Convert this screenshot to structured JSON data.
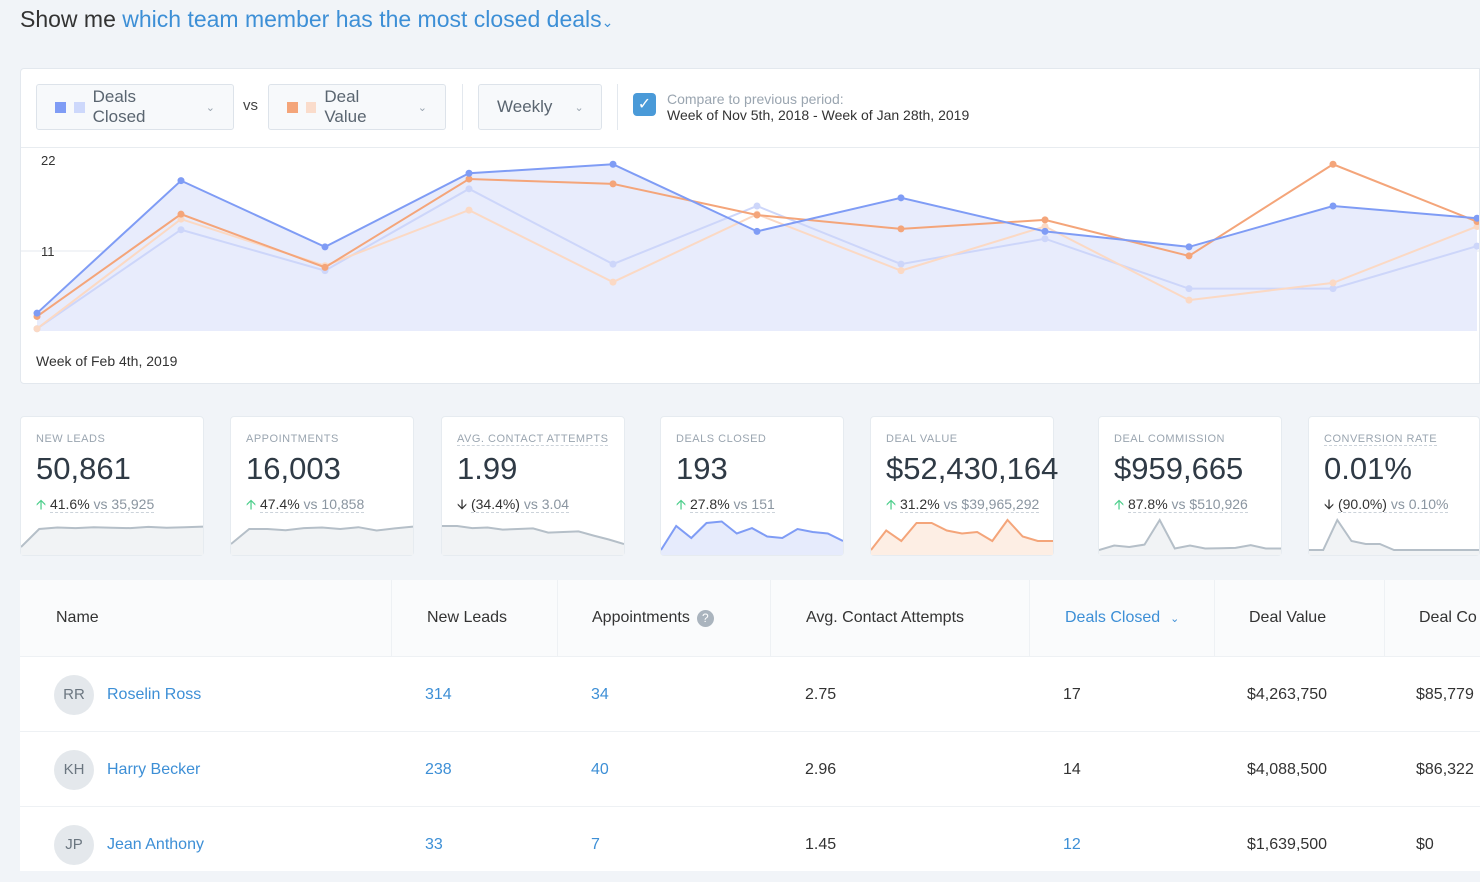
{
  "header": {
    "prefix": "Show me",
    "query": "which team member has the most closed deals",
    "chevron": "chevron-down-icon"
  },
  "controls": {
    "metric1": {
      "label": "Deals Closed",
      "colors": [
        "#7f9cf5",
        "#cdd8fb"
      ]
    },
    "vs": "vs",
    "metric2": {
      "label": "Deal Value",
      "colors": [
        "#f4a57a",
        "#fadccb"
      ]
    },
    "interval": "Weekly",
    "compare": {
      "checked": true,
      "label": "Compare to previous period:",
      "range": "Week of Nov 5th, 2018 - Week of Jan 28th, 2019"
    }
  },
  "chart_data": {
    "type": "line",
    "yticks": [
      "22",
      "11"
    ],
    "ylim": [
      0,
      22
    ],
    "xlabel": "Week of Feb 4th, 2019",
    "grid": true,
    "series": [
      {
        "key": "deals_prev",
        "color": "#cdd6fa",
        "values": [
          1.5,
          13.6,
          8.6,
          18.6,
          9.4,
          16.5,
          9.4,
          12.5,
          6.4,
          6.4,
          11.6
        ]
      },
      {
        "key": "value_prev",
        "color": "#fbd9c4",
        "values": [
          1.5,
          14.9,
          9.2,
          16,
          7.2,
          15.5,
          8.6,
          14,
          5,
          7.1,
          14
        ]
      },
      {
        "key": "value",
        "color": "#f4a57a",
        "values": [
          3,
          15.5,
          9,
          19.8,
          19.2,
          15.4,
          13.7,
          14.8,
          10.4,
          21.6,
          14.6
        ]
      },
      {
        "key": "deals",
        "color": "#7f9cf5",
        "values": [
          3.4,
          19.6,
          11.5,
          20.5,
          21.6,
          13.4,
          17.5,
          13.4,
          11.5,
          16.5,
          15
        ]
      }
    ]
  },
  "kpis": [
    {
      "label": "NEW LEADS",
      "value": "50,861",
      "dir": "up",
      "change": "41.6%",
      "vs": "vs 35,925",
      "color": "#b5bfc8",
      "fill": "#f1f3f5",
      "spark": [
        2,
        8,
        8.5,
        8.3,
        8.6,
        8.4,
        8.3,
        8.7,
        8.4,
        8.6,
        8.8
      ]
    },
    {
      "label": "APPOINTMENTS",
      "value": "16,003",
      "dir": "up",
      "change": "47.4%",
      "vs": "vs 10,858",
      "color": "#b5bfc8",
      "fill": "#f1f3f5",
      "spark": [
        3,
        8,
        8,
        7.6,
        8.3,
        8.5,
        8,
        8.6,
        7.5,
        8.2,
        8.8
      ]
    },
    {
      "label": "AVG. CONTACT ATTEMPTS",
      "value": "1.99",
      "dir": "down",
      "change": "(34.4%)",
      "vs": "vs 3.04",
      "color": "#b5bfc8",
      "fill": "#f1f3f5",
      "spark": [
        9,
        9,
        8.3,
        8.5,
        7.8,
        8,
        8.2,
        6.8,
        7,
        7.2,
        5.8,
        4.5,
        3
      ]
    },
    {
      "label": "DEALS CLOSED",
      "value": "193",
      "dir": "up",
      "change": "27.8%",
      "vs": "vs 151",
      "color": "#7f9cf5",
      "fill": "#e6ebfc",
      "spark": [
        1,
        9,
        5,
        10,
        10.5,
        6.5,
        8.3,
        5.5,
        5,
        8,
        7,
        6.5,
        4
      ]
    },
    {
      "label": "DEAL VALUE",
      "value": "$52,430,164",
      "dir": "up",
      "change": "31.2%",
      "vs": "vs $39,965,292",
      "color": "#f4a57a",
      "fill": "#fdeee4",
      "spark": [
        1,
        7.5,
        4,
        10,
        10,
        7.5,
        6.5,
        7,
        4,
        11,
        5.5,
        4,
        4
      ]
    },
    {
      "label": "DEAL COMMISSION",
      "value": "$959,665",
      "dir": "up",
      "change": "87.8%",
      "vs": "vs $510,926",
      "color": "#b5bfc8",
      "fill": "#f1f3f5",
      "spark": [
        1,
        2.5,
        2,
        2.8,
        11,
        1.5,
        2.5,
        1.5,
        1.6,
        1.7,
        2.6,
        1.5,
        1.5
      ]
    },
    {
      "label": "CONVERSION RATE",
      "value": "0.01%",
      "dir": "down",
      "change": "(90.0%)",
      "vs": "vs 0.10%",
      "color": "#b5bfc8",
      "fill": "#f1f3f5",
      "spark": [
        1,
        1,
        11,
        4,
        3,
        3,
        1,
        1,
        1,
        1,
        1,
        1,
        1
      ]
    }
  ],
  "table": {
    "columns": [
      "Name",
      "New Leads",
      "Appointments",
      "Avg. Contact Attempts",
      "Deals Closed",
      "Deal Value",
      "Deal Co"
    ],
    "sorted_column": "Deals Closed",
    "rows": [
      {
        "initials": "RR",
        "name": "Roselin Ross",
        "new_leads": "314",
        "appointments": "34",
        "avg_contact": "2.75",
        "deals_closed": "17",
        "deal_value": "$4,263,750",
        "deal_commission": "$85,779"
      },
      {
        "initials": "KH",
        "name": "Harry Becker",
        "new_leads": "238",
        "appointments": "40",
        "avg_contact": "2.96",
        "deals_closed": "14",
        "deal_value": "$4,088,500",
        "deal_commission": "$86,322"
      },
      {
        "initials": "JP",
        "name": "Jean Anthony",
        "new_leads": "33",
        "appointments": "7",
        "avg_contact": "1.45",
        "deals_closed": "12",
        "deal_value": "$1,639,500",
        "deal_commission": "$0"
      }
    ]
  }
}
